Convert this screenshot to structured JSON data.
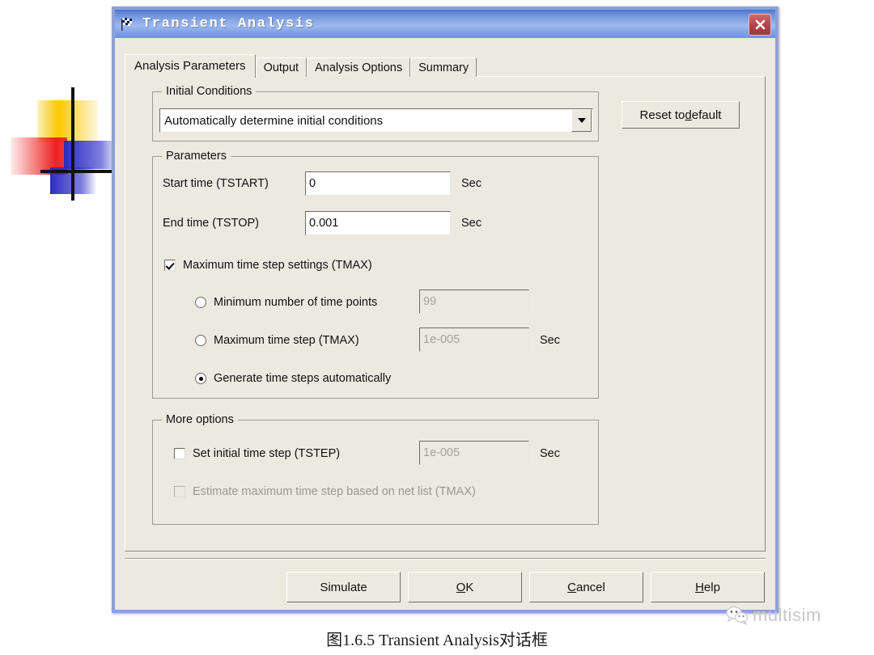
{
  "window": {
    "title": "Transient Analysis",
    "icon": "checkered-flag-icon",
    "close_label": "×",
    "frame_color": "#8da0d8",
    "titlebar_color": "#6e92dd",
    "body_color": "#ece9e0"
  },
  "tabs": [
    {
      "label": "Analysis Parameters",
      "active": true
    },
    {
      "label": "Output",
      "active": false
    },
    {
      "label": "Analysis Options",
      "active": false
    },
    {
      "label": "Summary",
      "active": false
    }
  ],
  "initial_conditions": {
    "group_label": "Initial Conditions",
    "selected": "Automatically determine initial conditions"
  },
  "reset_button": {
    "pre": "Reset to ",
    "accel": "d",
    "post": "efault"
  },
  "parameters": {
    "group_label": "Parameters",
    "start_time": {
      "label": "Start time (TSTART)",
      "value": "0",
      "unit": "Sec"
    },
    "end_time": {
      "label": "End time (TSTOP)",
      "value": "0.001",
      "unit": "Sec"
    },
    "tmax_checkbox": {
      "label": "Maximum time step settings (TMAX)",
      "checked": true
    },
    "radio_min_points": {
      "label": "Minimum number of time points",
      "selected": false,
      "value": "99",
      "disabled": true
    },
    "radio_max_step": {
      "label": "Maximum time step (TMAX)",
      "selected": false,
      "value": "1e-005",
      "unit": "Sec",
      "disabled": true
    },
    "radio_auto": {
      "label": "Generate time steps automatically",
      "selected": true
    }
  },
  "more_options": {
    "group_label": "More options",
    "set_initial_step": {
      "label": "Set initial time step (TSTEP)",
      "checked": false,
      "value": "1e-005",
      "unit": "Sec",
      "field_disabled": true
    },
    "estimate_max_step": {
      "label": "Estimate maximum time step based on net list (TMAX)",
      "checked": false,
      "disabled": true
    }
  },
  "footer_buttons": {
    "simulate": {
      "pre": "",
      "accel": "",
      "post": "Simulate"
    },
    "ok": {
      "pre": "",
      "accel": "O",
      "post": "K"
    },
    "cancel": {
      "pre": "",
      "accel": "C",
      "post": "ancel"
    },
    "help": {
      "pre": "",
      "accel": "H",
      "post": "elp"
    }
  },
  "caption": "图1.6.5  Transient Analysis对话框",
  "watermark": {
    "text": "multisim",
    "icon": "wechat-icon"
  }
}
